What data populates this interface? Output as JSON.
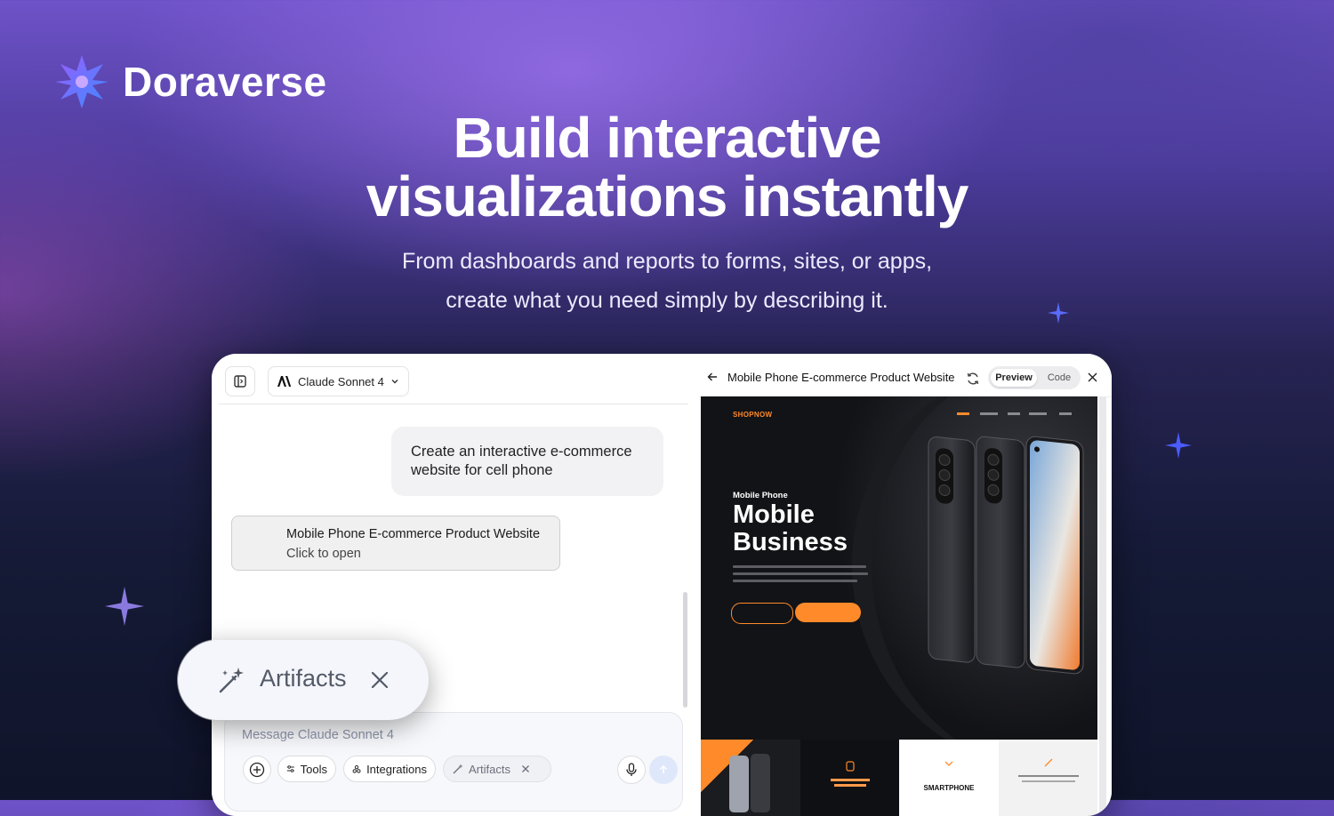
{
  "brand": {
    "name": "Doraverse"
  },
  "hero": {
    "headline_line1": "Build interactive",
    "headline_line2": "visualizations instantly",
    "subline_line1": "From dashboards and reports to forms, sites, or apps,",
    "subline_line2": "create what you need simply by describing it."
  },
  "chat": {
    "model_label": "Claude Sonnet 4",
    "user_message": "Create an interactive e-commerce website for cell phone",
    "artifact_card": {
      "title": "Mobile Phone E-commerce Product Website",
      "subtitle": "Click to open"
    },
    "input": {
      "placeholder": "Message Claude Sonnet 4",
      "tools_label": "Tools",
      "integrations_label": "Integrations",
      "artifacts_label": "Artifacts"
    }
  },
  "preview": {
    "title": "Mobile Phone E-commerce Product Website",
    "tab_preview": "Preview",
    "tab_code": "Code",
    "site": {
      "logo": "SHOPNOW",
      "eyebrow": "Mobile Phone",
      "heading_line1": "Mobile",
      "heading_line2": "Business",
      "tile_label": "SMARTPHONE"
    }
  },
  "artifacts_chip": {
    "label": "Artifacts"
  },
  "colors": {
    "accent": "#ff8a2a",
    "brand_purple": "#7b4fe0",
    "brand_blue": "#3d7bff"
  }
}
